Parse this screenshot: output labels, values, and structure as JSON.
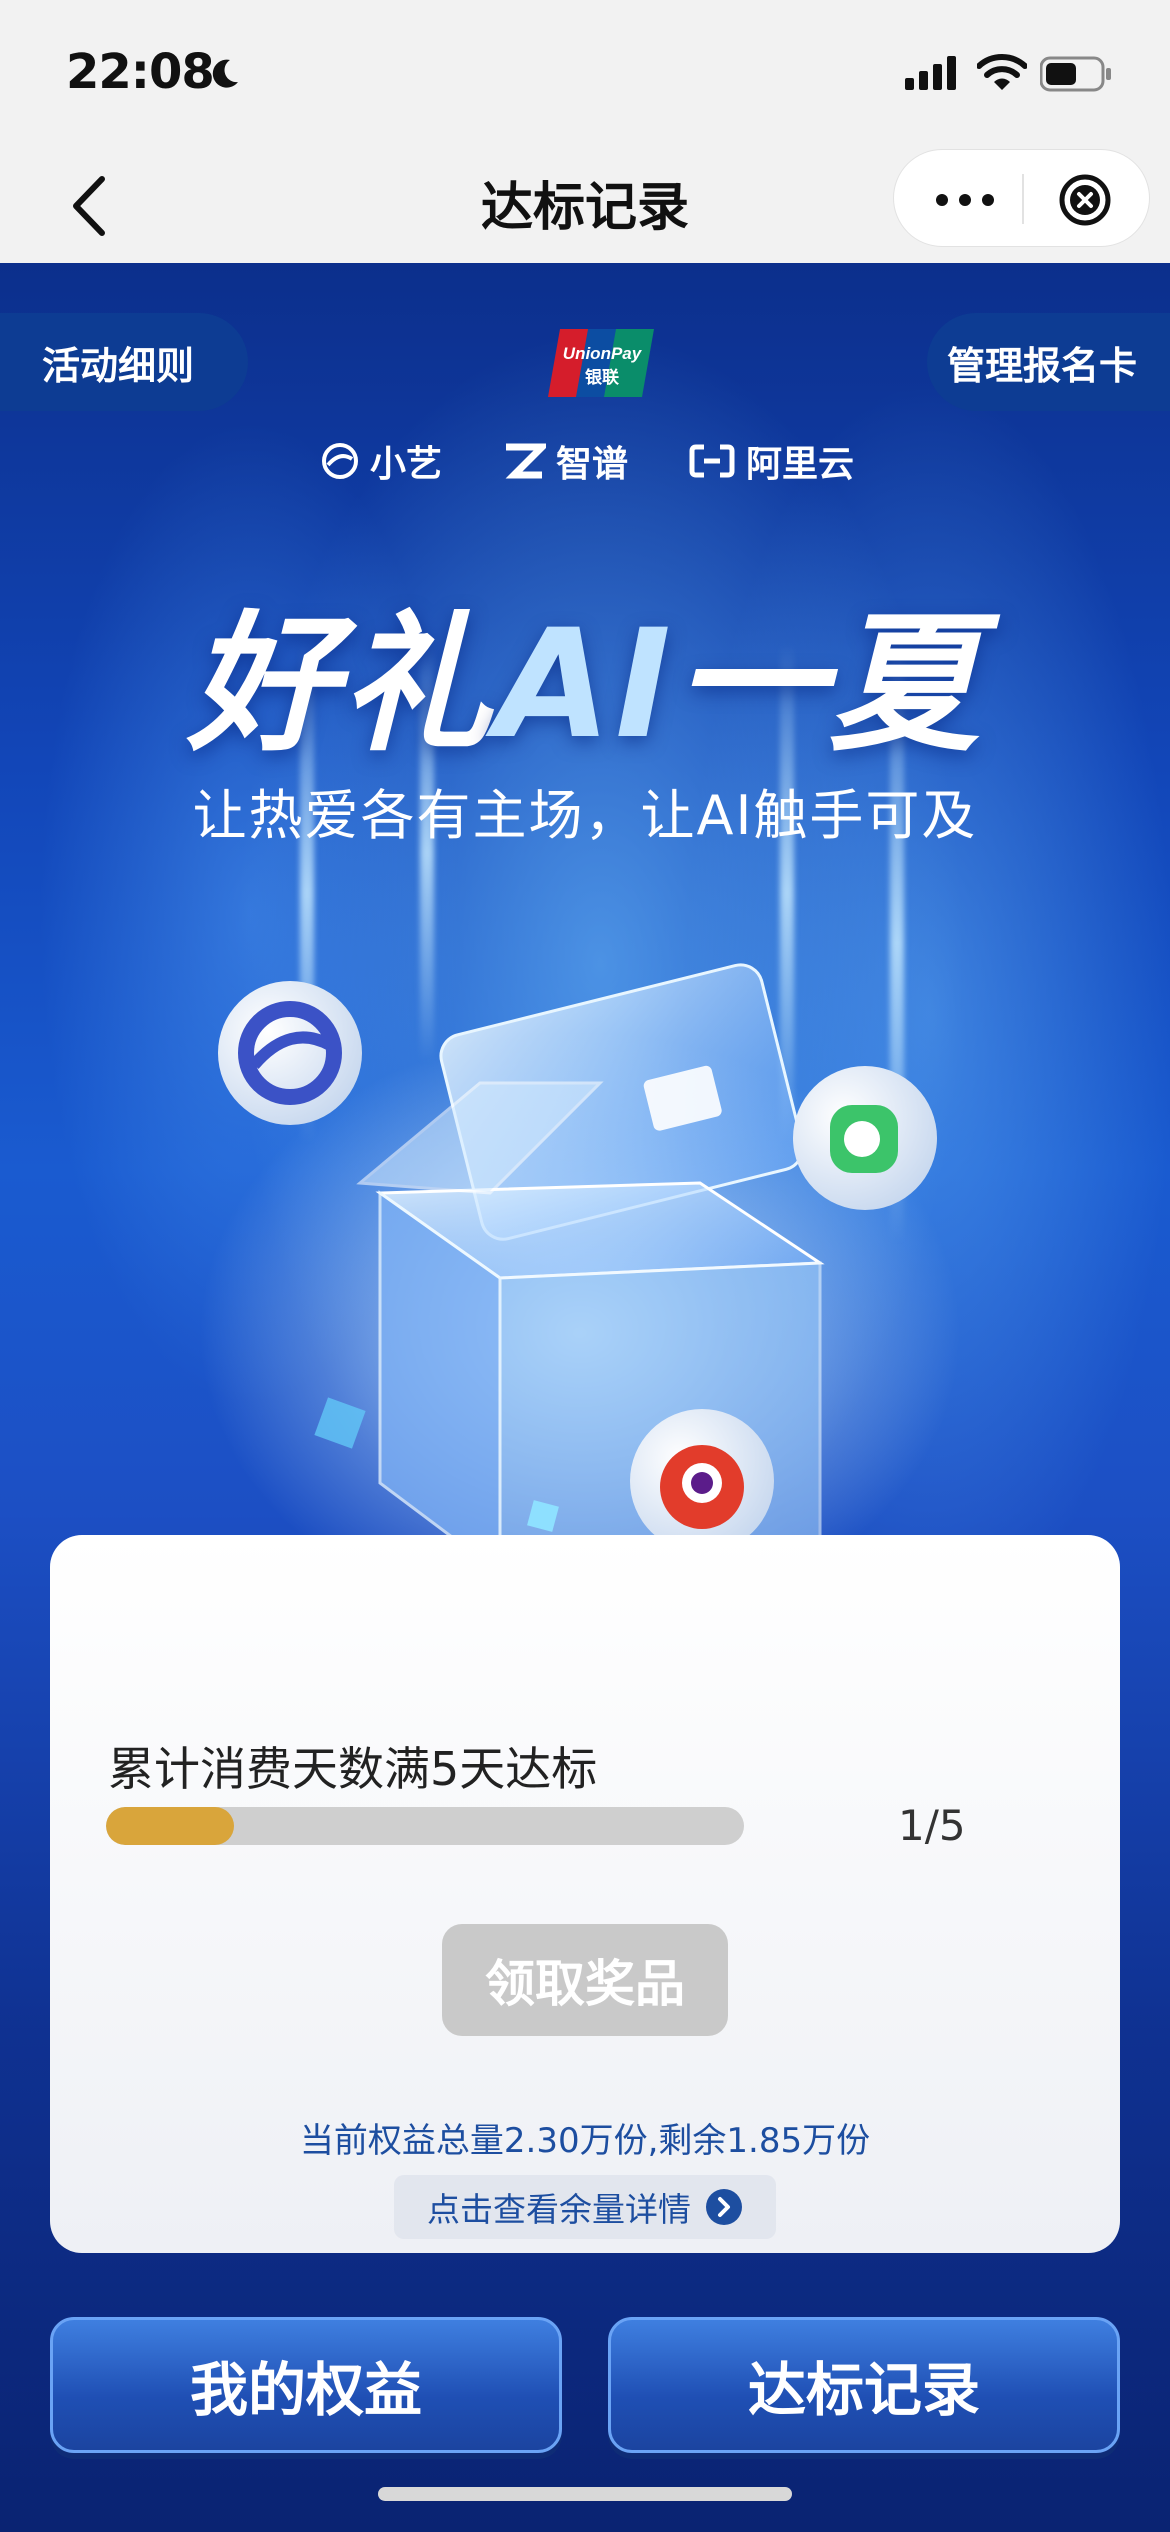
{
  "status_bar": {
    "time": "22:08",
    "icons": [
      "moon-icon",
      "signal-icon",
      "wifi-icon",
      "battery-icon"
    ]
  },
  "nav": {
    "title": "达标记录",
    "back_icon": "chevron-left-icon",
    "more_icon": "more-icon",
    "close_icon": "close-circle-icon"
  },
  "hero": {
    "rules_label": "活动细则",
    "manage_card_label": "管理报名卡",
    "brand_logo": "UnionPay 银联",
    "partners": [
      {
        "icon": "xiaoyi-logo-icon",
        "label": "小艺"
      },
      {
        "icon": "zhipu-logo-icon",
        "label": "智谱"
      },
      {
        "icon": "aliyun-logo-icon",
        "label": "阿里云"
      }
    ],
    "headline_part1": "好礼",
    "headline_ai": "AI",
    "headline_part2": "一夏",
    "subline": "让热爱各有主场，让AI触手可及"
  },
  "card": {
    "task_title": "累计消费天数满5天达标",
    "progress_text": "1/5",
    "progress_value": 0.2,
    "claim_label": "领取奖品",
    "quota_text": "当前权益总量2.30万份,剩余1.85万份",
    "detail_label": "点击查看余量详情"
  },
  "bottom": {
    "my_benefits_label": "我的权益",
    "records_label": "达标记录"
  },
  "colors": {
    "progress_fill": "#d9a53b",
    "progress_track": "#cfcfcf",
    "primary_blue": "#1d4ea0",
    "button_blue": "#1f4fb4"
  }
}
